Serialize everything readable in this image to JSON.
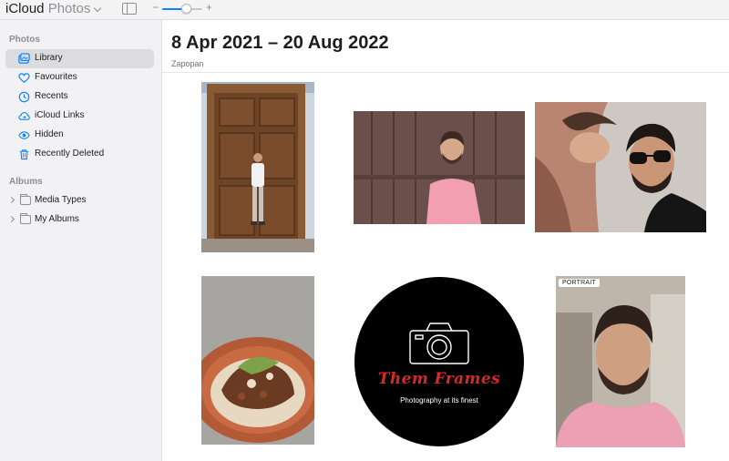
{
  "toolbar": {
    "brand": "iCloud",
    "product": "Photos",
    "zoom_minus": "−",
    "zoom_plus": "+",
    "zoom_level": 0.6
  },
  "sidebar": {
    "photos_section": "Photos",
    "items": [
      {
        "label": "Library",
        "icon": "library-icon"
      },
      {
        "label": "Favourites",
        "icon": "heart-icon"
      },
      {
        "label": "Recents",
        "icon": "clock-icon"
      },
      {
        "label": "iCloud Links",
        "icon": "cloud-icon"
      },
      {
        "label": "Hidden",
        "icon": "eye-icon"
      },
      {
        "label": "Recently Deleted",
        "icon": "trash-icon"
      }
    ],
    "albums_section": "Albums",
    "albums": [
      {
        "label": "Media Types",
        "icon": "folder-icon"
      },
      {
        "label": "My Albums",
        "icon": "folder-icon"
      }
    ]
  },
  "main": {
    "date_range": "8 Apr 2021 – 20 Aug 2022",
    "location": "Zapopan",
    "photos": [
      {
        "subject": "man-at-wooden-door"
      },
      {
        "subject": "man-in-pink-shirt-by-wooden-wall"
      },
      {
        "subject": "couple-selfie"
      },
      {
        "subject": "taco-on-plate"
      },
      {
        "subject": "them-frames-logo",
        "logo_title": "Them Frames",
        "logo_tagline": "Photography at its finest"
      },
      {
        "subject": "portrait-selfie",
        "badge": "PORTRAIT"
      }
    ]
  },
  "colors": {
    "accent": "#0a84ff",
    "selected_bg": "#dcdcdf",
    "sidebar_bg": "#f2f2f4"
  }
}
